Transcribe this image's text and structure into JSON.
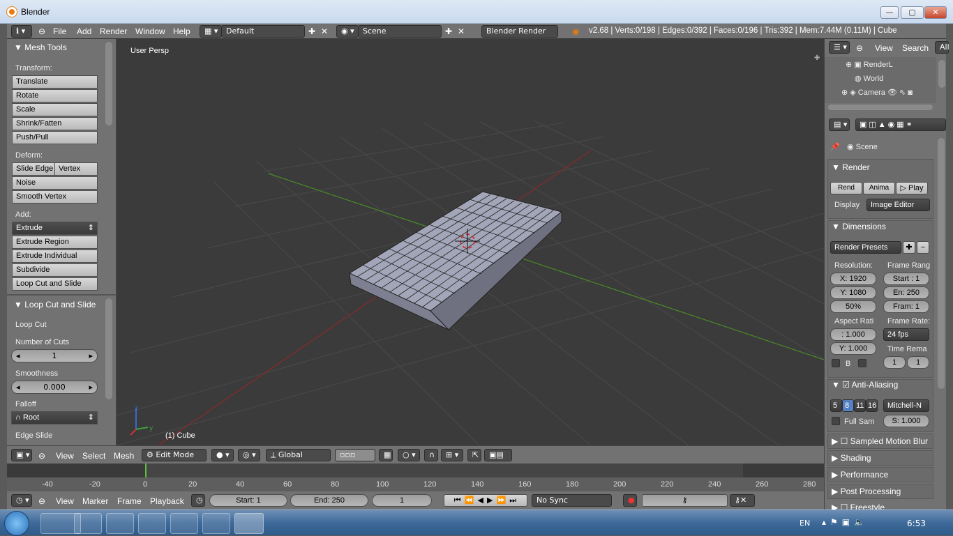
{
  "window": {
    "title": "Blender",
    "minimize": "—",
    "maximize": "▢",
    "close": "✕"
  },
  "menus": [
    "File",
    "Add",
    "Render",
    "Window",
    "Help"
  ],
  "layout": "Default",
  "scene": "Scene",
  "engine": "Blender Render",
  "stats": "v2.68 | Verts:0/198 | Edges:0/392 | Faces:0/196 | Tris:392 | Mem:7.44M (0.11M) | Cube",
  "tools": {
    "title": "Mesh Tools",
    "transform_label": "Transform:",
    "transform": [
      "Translate",
      "Rotate",
      "Scale",
      "Shrink/Fatten",
      "Push/Pull"
    ],
    "deform_label": "Deform:",
    "slide_edge": "Slide Edge",
    "vertex": "Vertex",
    "noise": "Noise",
    "smooth_vertex": "Smooth Vertex",
    "add_label": "Add:",
    "extrude": "Extrude",
    "add": [
      "Extrude Region",
      "Extrude Individual",
      "Subdivide",
      "Loop Cut and Slide"
    ]
  },
  "operator": {
    "title": "Loop Cut and Slide",
    "loop_cut": "Loop Cut",
    "cuts_label": "Number of Cuts",
    "cuts": "1",
    "smooth_label": "Smoothness",
    "smooth": "0.000",
    "falloff_label": "Falloff",
    "falloff": "Root",
    "edge_slide": "Edge Slide"
  },
  "viewport": {
    "view_name": "User Persp",
    "object_label": "(1) Cube"
  },
  "vpheader": {
    "view": "View",
    "select": "Select",
    "mesh": "Mesh",
    "mode": "Edit Mode",
    "orientation": "Global"
  },
  "timeline": {
    "ticks": [
      "-40",
      "-20",
      "0",
      "20",
      "40",
      "60",
      "80",
      "100",
      "120",
      "140",
      "160",
      "180",
      "200",
      "220",
      "240",
      "260",
      "280"
    ],
    "view": "View",
    "marker": "Marker",
    "frame": "Frame",
    "playback": "Playback",
    "start": "Start: 1",
    "end": "End: 250",
    "current": "1",
    "sync": "No Sync"
  },
  "outliner": {
    "view": "View",
    "search": "Search",
    "all": "All",
    "items": [
      "RenderL",
      "World",
      "Camera"
    ]
  },
  "props": {
    "scene": "Scene",
    "render_title": "Render",
    "render_btn": "Rend",
    "anim_btn": "Anima",
    "play_btn": "Play",
    "display_label": "Display",
    "display": "Image Editor",
    "dimensions": "Dimensions",
    "presets": "Render Presets",
    "resolution": "Resolution:",
    "res_x": "X: 1920",
    "res_y": "Y: 1080",
    "res_pct": "50%",
    "frame_range": "Frame Rang",
    "start": "Start : 1",
    "end": "En: 250",
    "fram": "Fram: 1",
    "aspect": "Aspect Rati",
    "asp_x": ": 1.000",
    "asp_y": "Y: 1.000",
    "frame_rate": "Frame Rate:",
    "fps": "24 fps",
    "time_remap": "Time Rema",
    "t1": "1",
    "t2": "1",
    "b": "B",
    "aa": "Anti-Aliasing",
    "aa_samples": [
      "5",
      "8",
      "11",
      "16"
    ],
    "aa_filter": "Mitchell-N",
    "full_sample": "Full Sam",
    "aa_size": "S: 1.000",
    "sampled_motion": "Sampled Motion Blur",
    "shading": "Shading",
    "performance": "Performance",
    "post": "Post Processing",
    "freestyle": "Freestyle"
  },
  "taskbar": {
    "lang": "EN",
    "time": "6:53"
  }
}
